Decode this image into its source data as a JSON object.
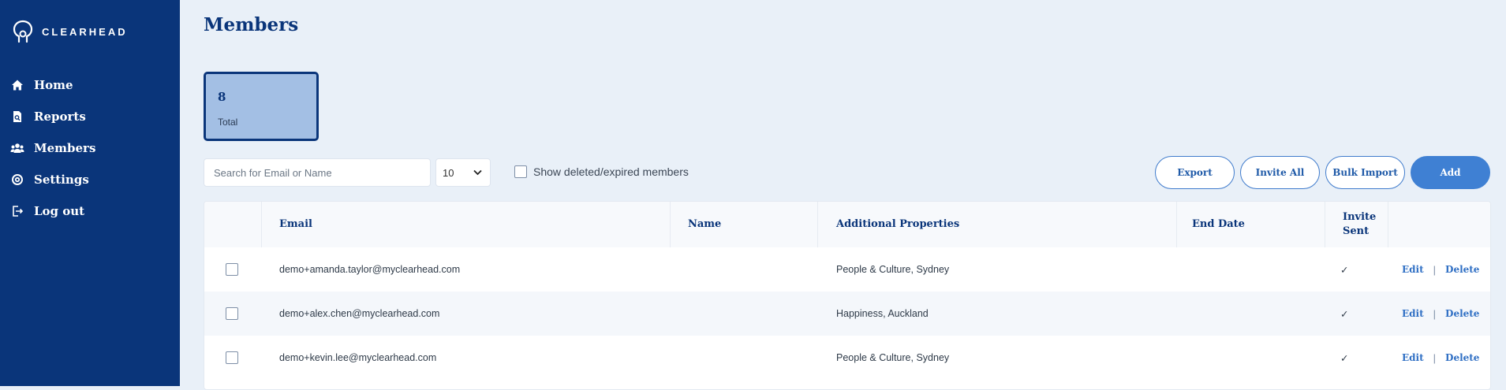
{
  "app": {
    "brand": "CLEARHEAD"
  },
  "sidebar": {
    "items": [
      {
        "label": "Home",
        "icon": "home-icon"
      },
      {
        "label": "Reports",
        "icon": "report-icon"
      },
      {
        "label": "Members",
        "icon": "members-icon"
      },
      {
        "label": "Settings",
        "icon": "settings-icon"
      },
      {
        "label": "Log out",
        "icon": "logout-icon"
      }
    ]
  },
  "page": {
    "title": "Members"
  },
  "stats": {
    "value": "8",
    "label": "Total"
  },
  "controls": {
    "search_placeholder": "Search for Email or Name",
    "page_size": "10",
    "show_deleted_label": "Show deleted/expired members",
    "export_label": "Export",
    "invite_all_label": "Invite All",
    "bulk_import_label": "Bulk Import",
    "add_label": "Add"
  },
  "table": {
    "headers": {
      "email": "Email",
      "name": "Name",
      "additional": "Additional Properties",
      "end_date": "End Date",
      "invite_sent_1": "Invite",
      "invite_sent_2": "Sent"
    },
    "rows": [
      {
        "email": "demo+amanda.taylor@myclearhead.com",
        "name": "",
        "additional": "People & Culture, Sydney",
        "end_date": "",
        "invite_sent": "✓",
        "edit": "Edit",
        "sep": "|",
        "delete": "Delete"
      },
      {
        "email": "demo+alex.chen@myclearhead.com",
        "name": "",
        "additional": "Happiness, Auckland",
        "end_date": "",
        "invite_sent": "✓",
        "edit": "Edit",
        "sep": "|",
        "delete": "Delete"
      },
      {
        "email": "demo+kevin.lee@myclearhead.com",
        "name": "",
        "additional": "People & Culture, Sydney",
        "end_date": "",
        "invite_sent": "✓",
        "edit": "Edit",
        "sep": "|",
        "delete": "Delete"
      }
    ]
  },
  "colors": {
    "sidebar_bg": "#0a357a",
    "page_bg": "#e9f0f8",
    "accent": "#3f80d3",
    "card_bg": "#a3bfe4"
  }
}
